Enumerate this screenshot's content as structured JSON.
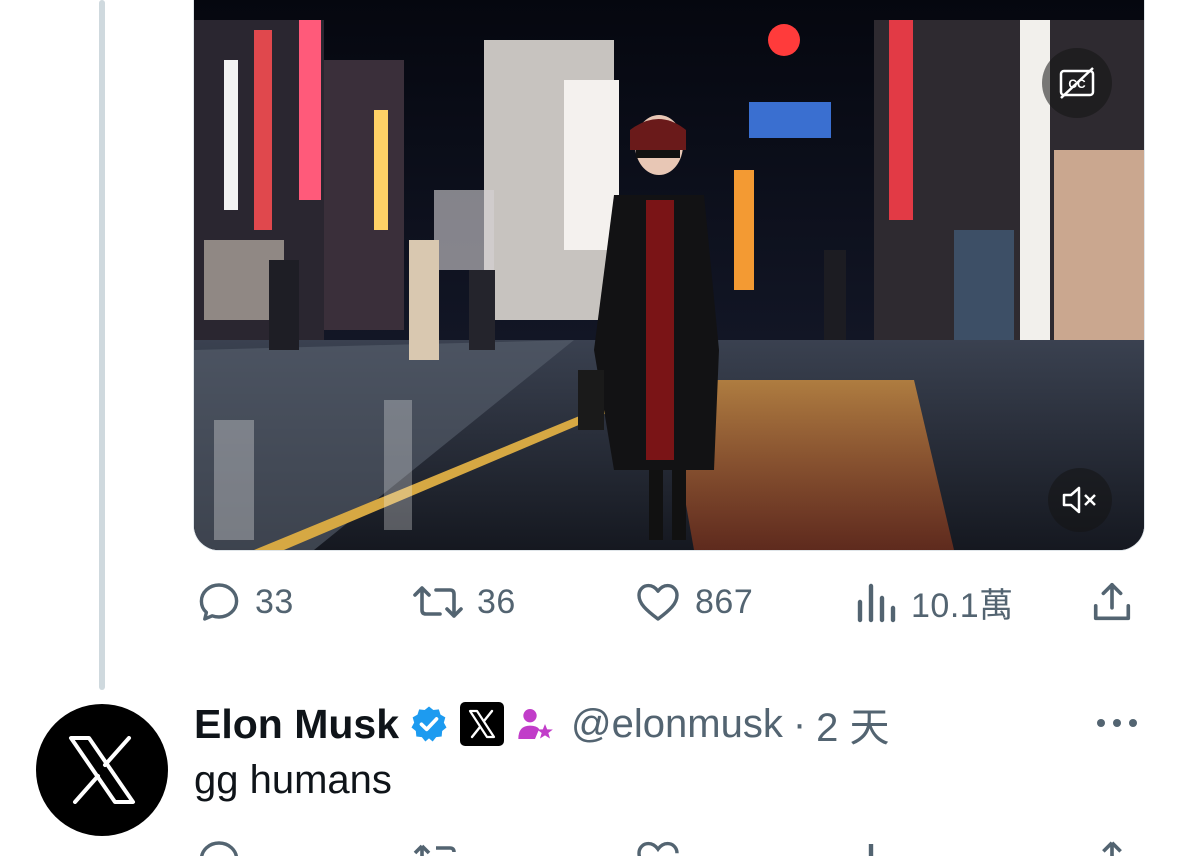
{
  "previous_tweet": {
    "media": {
      "captions_icon": "captions-off-icon",
      "mute_icon": "speaker-muted-icon"
    },
    "actions": {
      "replies": "33",
      "reposts": "36",
      "likes": "867",
      "views": "10.1萬"
    },
    "icons": [
      "reply-icon",
      "repost-icon",
      "like-icon",
      "views-icon",
      "share-icon"
    ]
  },
  "reply_tweet": {
    "display_name": "Elon Musk",
    "handle": "@elonmusk",
    "separator": "·",
    "time": "2 天",
    "text": "gg humans",
    "badges": [
      "verified-badge-icon",
      "x-affiliate-badge-icon",
      "automated-account-icon"
    ],
    "colors": {
      "verified": "#1d9bf0",
      "automated": "#c13dc9"
    }
  },
  "colors": {
    "thread_line": "#cfd9de",
    "secondary_text": "#536471",
    "primary_text": "#0f1419"
  }
}
